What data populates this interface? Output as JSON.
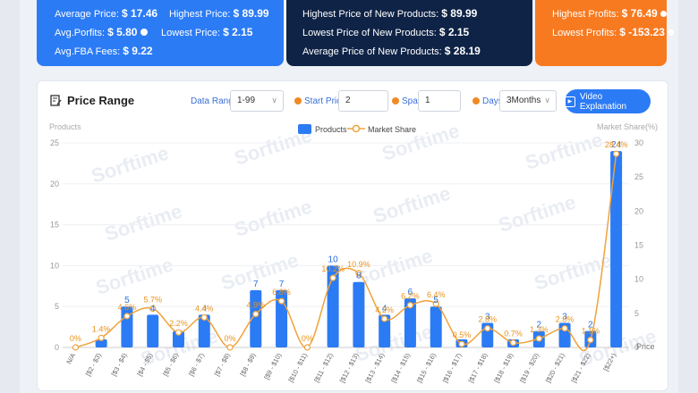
{
  "stats": {
    "blue": {
      "avg_price_label": "Average Price:",
      "avg_price": "$ 17.46",
      "highest_price_label": "Highest Price:",
      "highest_price": "$ 89.99",
      "avg_profits_label": "Avg.Porfits:",
      "avg_profits": "$ 5.80",
      "lowest_price_label": "Lowest Price:",
      "lowest_price": "$ 2.15",
      "avg_fba_label": "Avg.FBA Fees:",
      "avg_fba": "$ 9.22"
    },
    "navy": {
      "highest_new_label": "Highest Price of New Products:",
      "highest_new": "$ 89.99",
      "lowest_new_label": "Lowest Price of New Products:",
      "lowest_new": "$ 2.15",
      "avg_new_label": "Average Price of New Products:",
      "avg_new": "$ 28.19"
    },
    "orange": {
      "highest_profits_label": "Highest Profits:",
      "highest_profits": "$ 76.49",
      "lowest_profits_label": "Lowest Profits:",
      "lowest_profits": "$ -153.23"
    }
  },
  "panel": {
    "title": "Price Range",
    "data_range_label": "Data Range",
    "data_range_value": "1-99",
    "start_price_label": "Start Price",
    "start_price_value": "2",
    "span_label": "Span",
    "span_value": "1",
    "days_label": "Days",
    "days_value": "3Months",
    "video_button": "Video Explanation"
  },
  "watermark": "Sorftime",
  "colors": {
    "bar": "#2b7bf5",
    "line": "#f0a23a",
    "blue_card": "#2b7bf5",
    "navy_card": "#0f2346",
    "orange_card": "#f77a21"
  },
  "chart_data": {
    "type": "bar",
    "ylabel_left": "Products",
    "ylabel_right": "Market Share(%)",
    "xlabel": "Price",
    "legend": [
      "Products",
      "Market Share"
    ],
    "ylim_left": [
      0,
      25
    ],
    "ylim_right": [
      0,
      30
    ],
    "yticks_left": [
      0,
      5,
      10,
      15,
      20,
      25
    ],
    "yticks_right": [
      0,
      5,
      10,
      15,
      20,
      25,
      30
    ],
    "categories": [
      "N/A",
      "[$2 - $3)",
      "[$3 - $4)",
      "[$4 - $5)",
      "[$5 - $6)",
      "[$6 - $7)",
      "[$7 - $8)",
      "[$8 - $9)",
      "[$9 - $10)",
      "[$10 - $11)",
      "[$11 - $12)",
      "[$12 - $13)",
      "[$13 - $14)",
      "[$14 - $15)",
      "[$15 - $16)",
      "[$16 - $17)",
      "[$17 - $18)",
      "[$18 - $19)",
      "[$19 - $20)",
      "[$20 - $21)",
      "[$21 - $22)",
      "[$22+)"
    ],
    "series": [
      {
        "name": "Products",
        "values": [
          0,
          1,
          5,
          4,
          2,
          4,
          0,
          7,
          7,
          0,
          10,
          8,
          4,
          6,
          5,
          1,
          3,
          1,
          2,
          3,
          2,
          24
        ],
        "labels": [
          "",
          "",
          "5",
          "4",
          "",
          "4",
          "",
          "7",
          "7",
          "",
          "10",
          "8",
          "4",
          "6",
          "5",
          "",
          "3",
          "",
          "2",
          "3",
          "2",
          "24"
        ]
      },
      {
        "name": "Market Share",
        "values": [
          0,
          1.4,
          4.6,
          5.7,
          2.2,
          4.4,
          0,
          4.9,
          6.8,
          0,
          10.2,
          10.9,
          4.2,
          6.2,
          6.4,
          0.5,
          2.8,
          0.7,
          1.3,
          2.8,
          1.1,
          28.4
        ],
        "labels": [
          "0%",
          "1.4%",
          "4.6%",
          "5.7%",
          "2.2%",
          "4.4%",
          "0%",
          "4.9%",
          "6.8%",
          "0%",
          "10.2%",
          "10.9%",
          "4.2%",
          "6.2%",
          "6.4%",
          "0.5%",
          "2.8%",
          "0.7%",
          "1.3%",
          "2.8%",
          "1.1%",
          "28.4%"
        ]
      }
    ]
  }
}
